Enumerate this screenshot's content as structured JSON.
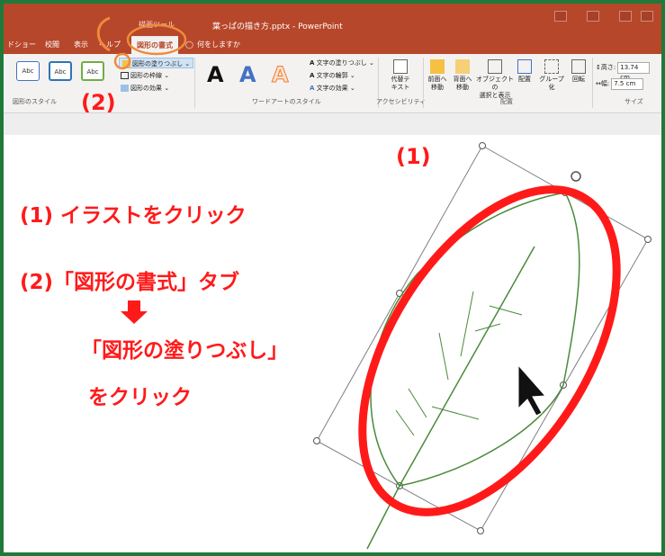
{
  "window": {
    "context_tab_group": "描画ツール",
    "document_title": "葉っぱの描き方.pptx - PowerPoint"
  },
  "tabs": [
    {
      "label": "ドショー"
    },
    {
      "label": "校閲"
    },
    {
      "label": "表示"
    },
    {
      "label": "ヘルプ"
    },
    {
      "label": "図形の書式"
    }
  ],
  "tell_me": "何をしますか",
  "ribbon": {
    "shape_styles": {
      "sample_label": "Abc",
      "fill_label": "図形の塗りつぶし",
      "outline_label": "図形の枠線",
      "effects_label": "図形の効果",
      "group_label": "図形のスタイル"
    },
    "wordart": {
      "sample": "A",
      "text_fill": "文字の塗りつぶし",
      "text_outline": "文字の輪郭",
      "text_effects": "文字の効果",
      "group_label": "ワードアートのスタイル"
    },
    "accessibility": {
      "alt_text_line1": "代替テ",
      "alt_text_line2": "キスト",
      "group_label": "アクセシビリティ"
    },
    "arrange": {
      "bring_forward_1": "前面へ",
      "bring_forward_2": "移動",
      "send_backward_1": "背面へ",
      "send_backward_2": "移動",
      "selection_pane_1": "オブジェクトの",
      "selection_pane_2": "選択と表示",
      "align": "配置",
      "group": "グループ化",
      "rotate": "回転",
      "group_label": "配置"
    },
    "size": {
      "height_label": "高さ:",
      "height_value": "13.74 cm",
      "width_label": "幅:",
      "width_value": "7.5 cm",
      "group_label": "サイズ"
    }
  },
  "annotations": {
    "step1_marker": "(1)",
    "step2_marker": "(2)",
    "line1": "(1) イラストをクリック",
    "line2": "(2)「図形の書式」タブ",
    "arrow": "↓",
    "line3": "「図形の塗りつぶし」",
    "line4": "をクリック"
  },
  "colors": {
    "accent_red": "#ff1a1a",
    "annotation_orange": "#f08a3c",
    "powerpoint_brand": "#b7472a",
    "leaf_line": "#4a8a3a",
    "border_green": "#1f7a3a"
  }
}
